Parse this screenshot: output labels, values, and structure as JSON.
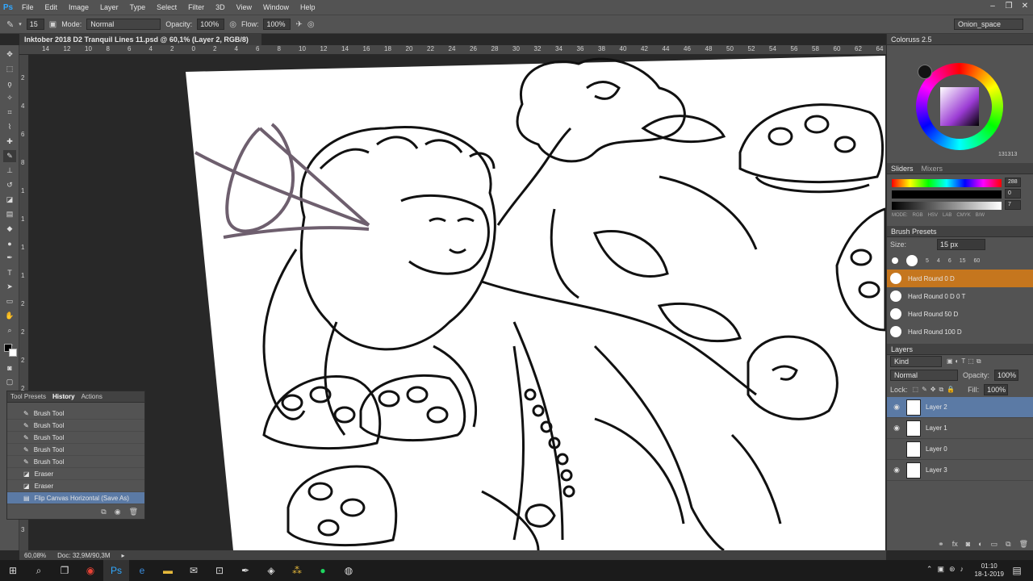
{
  "app": {
    "logo": "Ps"
  },
  "menu": [
    "File",
    "Edit",
    "Image",
    "Layer",
    "Type",
    "Select",
    "Filter",
    "3D",
    "View",
    "Window",
    "Help"
  ],
  "window_controls": [
    "–",
    "❐",
    "✕"
  ],
  "options": {
    "brush_size": "15",
    "mode_label": "Mode:",
    "mode_value": "Normal",
    "opacity_label": "Opacity:",
    "opacity_value": "100%",
    "flow_label": "Flow:",
    "flow_value": "100%",
    "workspace": "Onion_space"
  },
  "document_tab": "Inktober 2018 D2 Tranquil Lines 11.psd @ 60,1% (Layer 2, RGB/8)",
  "ruler_top": [
    "14",
    "12",
    "10",
    "8",
    "6",
    "4",
    "2",
    "0",
    "2",
    "4",
    "6",
    "8",
    "10",
    "12",
    "14",
    "16",
    "18",
    "20",
    "22",
    "24",
    "26",
    "28",
    "30",
    "32",
    "34",
    "36",
    "38",
    "40",
    "42",
    "44",
    "46",
    "48",
    "50",
    "52",
    "54",
    "56",
    "58",
    "60",
    "62",
    "64"
  ],
  "ruler_left": [
    "2",
    "4",
    "6",
    "8",
    "1",
    "1",
    "1",
    "1",
    "2",
    "2",
    "2",
    "2",
    "2",
    "3",
    "3",
    "3",
    "3"
  ],
  "panels": {
    "colours": {
      "title": "Coloruss 2.5",
      "hex": "131313"
    },
    "sliders_tabs": [
      "Sliders",
      "Mixers"
    ],
    "slider_values": [
      "288",
      "0",
      "7"
    ],
    "slider_modes": [
      "MODE:",
      "RGB",
      "HSV",
      "LAB",
      "CMYK",
      "B/W"
    ],
    "brush_presets": {
      "title": "Brush Presets",
      "size_label": "Size:",
      "size_value": "15 px",
      "size_numbers": [
        "5",
        "4",
        "6",
        "15",
        "60"
      ],
      "items": [
        "Hard Round 0 D",
        "Hard Round 0 D 0 T",
        "Hard Round 50 D",
        "Hard Round 100 D"
      ]
    },
    "layers": {
      "title": "Layers",
      "kind": "Kind",
      "blend": "Normal",
      "opacity_label": "Opacity:",
      "opacity_value": "100%",
      "lock_label": "Lock:",
      "fill_label": "Fill:",
      "fill_value": "100%",
      "items": [
        "Layer 2",
        "Layer 1",
        "Layer 0",
        "Layer 3"
      ]
    }
  },
  "history": {
    "tabs": [
      "Tool Presets",
      "History",
      "Actions"
    ],
    "items": [
      "Brush Tool",
      "Brush Tool",
      "Brush Tool",
      "Brush Tool",
      "Brush Tool",
      "Eraser",
      "Eraser",
      "Flip Canvas Horizontal (Save As)"
    ]
  },
  "status": {
    "zoom": "60,08%",
    "doc": "Doc: 32,9M/90,3M"
  },
  "clock": {
    "time": "01:10",
    "date": "18-1-2019"
  }
}
